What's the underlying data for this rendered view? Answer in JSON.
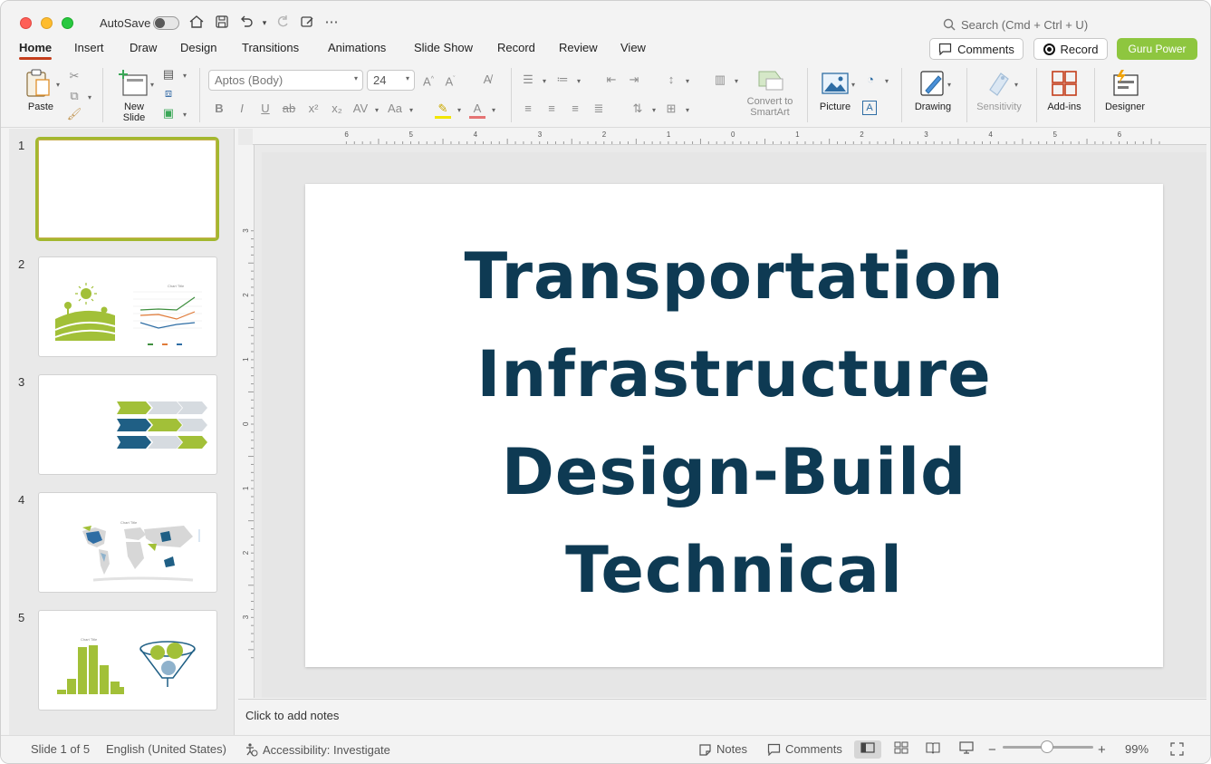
{
  "titlebar": {
    "autosave_label": "AutoSave",
    "search_placeholder": "Search (Cmd + Ctrl + U)"
  },
  "tabs": [
    "Home",
    "Insert",
    "Draw",
    "Design",
    "Transitions",
    "Animations",
    "Slide Show",
    "Record",
    "Review",
    "View"
  ],
  "header_buttons": {
    "comments": "Comments",
    "record": "Record",
    "guru": "Guru Power"
  },
  "ribbon": {
    "paste": "Paste",
    "new_slide_1": "New",
    "new_slide_2": "Slide",
    "font_name": "Aptos (Body)",
    "font_size": "24",
    "convert_1": "Convert to",
    "convert_2": "SmartArt",
    "picture": "Picture",
    "drawing": "Drawing",
    "sensitivity": "Sensitivity",
    "addins": "Add-ins",
    "designer": "Designer"
  },
  "thumbnails": [
    "1",
    "2",
    "3",
    "4",
    "5"
  ],
  "thumb_text": {
    "chart_title": "Chart Title"
  },
  "slide": {
    "title_lines": [
      "Transportation",
      "Infrastructure",
      "Design-Build",
      "Technical"
    ]
  },
  "notes_placeholder": "Click to add notes",
  "status": {
    "slide_count": "Slide 1 of 5",
    "language": "English (United States)",
    "accessibility": "Accessibility: Investigate",
    "notes": "Notes",
    "comments": "Comments",
    "zoom": "99%"
  },
  "ruler": {
    "h_labels": [
      "6",
      "5",
      "4",
      "3",
      "2",
      "1",
      "0",
      "1",
      "2",
      "3",
      "4",
      "5",
      "6"
    ],
    "v_labels": [
      "3",
      "2",
      "1",
      "0",
      "1",
      "2",
      "3"
    ]
  },
  "colors": {
    "accent": "#c43e1c",
    "slide_title": "#0e3a53",
    "guru_green": "#8ec63f",
    "thumb_green": "#a2c038",
    "thumb_blue": "#1f5f85"
  }
}
